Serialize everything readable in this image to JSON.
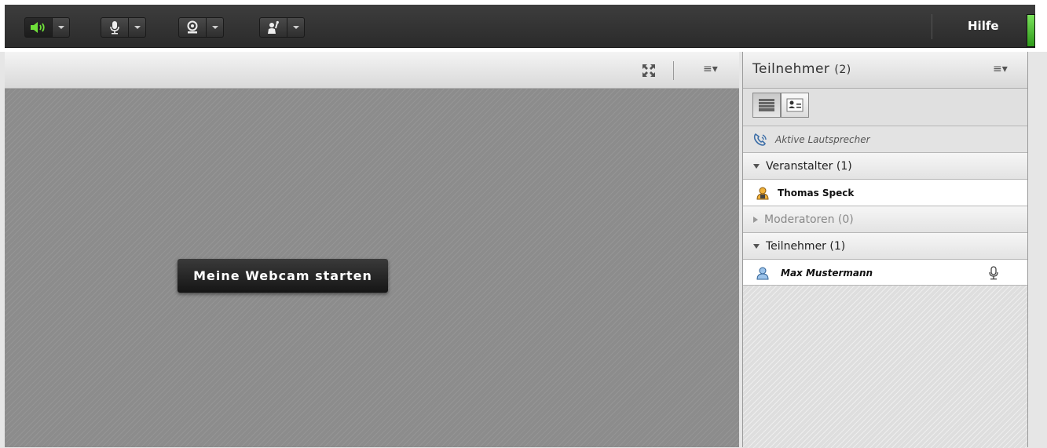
{
  "toolbar": {
    "help_label": "Hilfe",
    "buttons": [
      {
        "icon": "speaker-icon",
        "active": true
      },
      {
        "icon": "microphone-icon",
        "active": false
      },
      {
        "icon": "webcam-icon",
        "active": false
      },
      {
        "icon": "raise-hand-icon",
        "active": false
      }
    ]
  },
  "video_pod": {
    "start_webcam_label": "Meine Webcam starten",
    "menu_icon": "≡▾"
  },
  "attendees_pod": {
    "title": "Teilnehmer",
    "count": "(2)",
    "menu_icon": "≡▾",
    "active_speakers_label": "Aktive Lautsprecher",
    "sections": {
      "hosts": {
        "label": "Veranstalter (1)",
        "members": [
          "Thomas Speck"
        ]
      },
      "presenters": {
        "label": "Moderatoren (0)"
      },
      "participants": {
        "label": "Teilnehmer (1)",
        "members": [
          "Max Mustermann"
        ]
      }
    }
  },
  "colors": {
    "accent_green": "#5ccf2f",
    "toolbar_dark": "#333333",
    "pod_background": "#8c8c8c"
  }
}
